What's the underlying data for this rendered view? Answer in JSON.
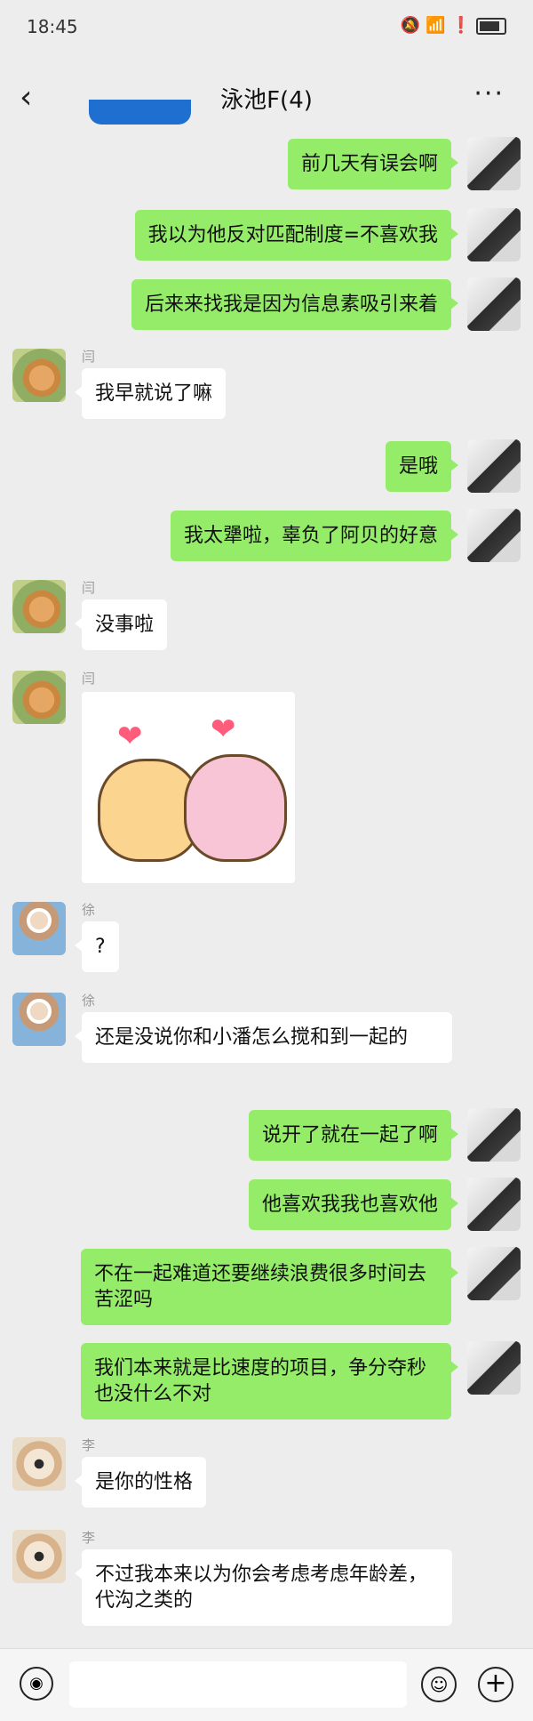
{
  "status_bar": {
    "time": "18:45",
    "icons": [
      "mute-icon",
      "wifi-icon",
      "alert-icon",
      "battery-icon"
    ]
  },
  "header": {
    "title": "泳池F(4)",
    "back_icon": "back-chevron-icon",
    "more_icon": "more-dots-icon"
  },
  "messages": [
    {
      "sender": "me",
      "text": "前几天有误会啊"
    },
    {
      "sender": "me",
      "text": "我以为他反对匹配制度=不喜欢我"
    },
    {
      "sender": "me",
      "text": "后来来找我是因为信息素吸引来着"
    },
    {
      "sender": "闫",
      "text": "我早就说了嘛"
    },
    {
      "sender": "me",
      "text": "是哦"
    },
    {
      "sender": "me",
      "text": "我太犟啦，辜负了阿贝的好意"
    },
    {
      "sender": "闫",
      "text": "没事啦"
    },
    {
      "sender": "闫",
      "type": "sticker",
      "sticker": "two-cartoon-pigs-with-hearts"
    },
    {
      "sender": "徐",
      "text": "?"
    },
    {
      "sender": "徐",
      "text": "还是没说你和小潘怎么搅和到一起的"
    },
    {
      "sender": "me",
      "text": "说开了就在一起了啊"
    },
    {
      "sender": "me",
      "text": "他喜欢我我也喜欢他"
    },
    {
      "sender": "me",
      "text": "不在一起难道还要继续浪费很多时间去苦涩吗"
    },
    {
      "sender": "me",
      "text": "我们本来就是比速度的项目，争分夺秒也没什么不对"
    },
    {
      "sender": "李",
      "text": "是你的性格"
    },
    {
      "sender": "李",
      "text": "不过我本来以为你会考虑考虑年龄差，代沟之类的"
    }
  ],
  "names": {
    "yan": "闫",
    "xu": "徐",
    "li": "李"
  },
  "bottom_bar": {
    "voice_icon": "voice-icon",
    "emoji_icon": "emoji-icon",
    "plus_icon": "plus-icon"
  },
  "colors": {
    "background": "#ededed",
    "my_bubble": "#95ec69",
    "other_bubble": "#ffffff"
  }
}
